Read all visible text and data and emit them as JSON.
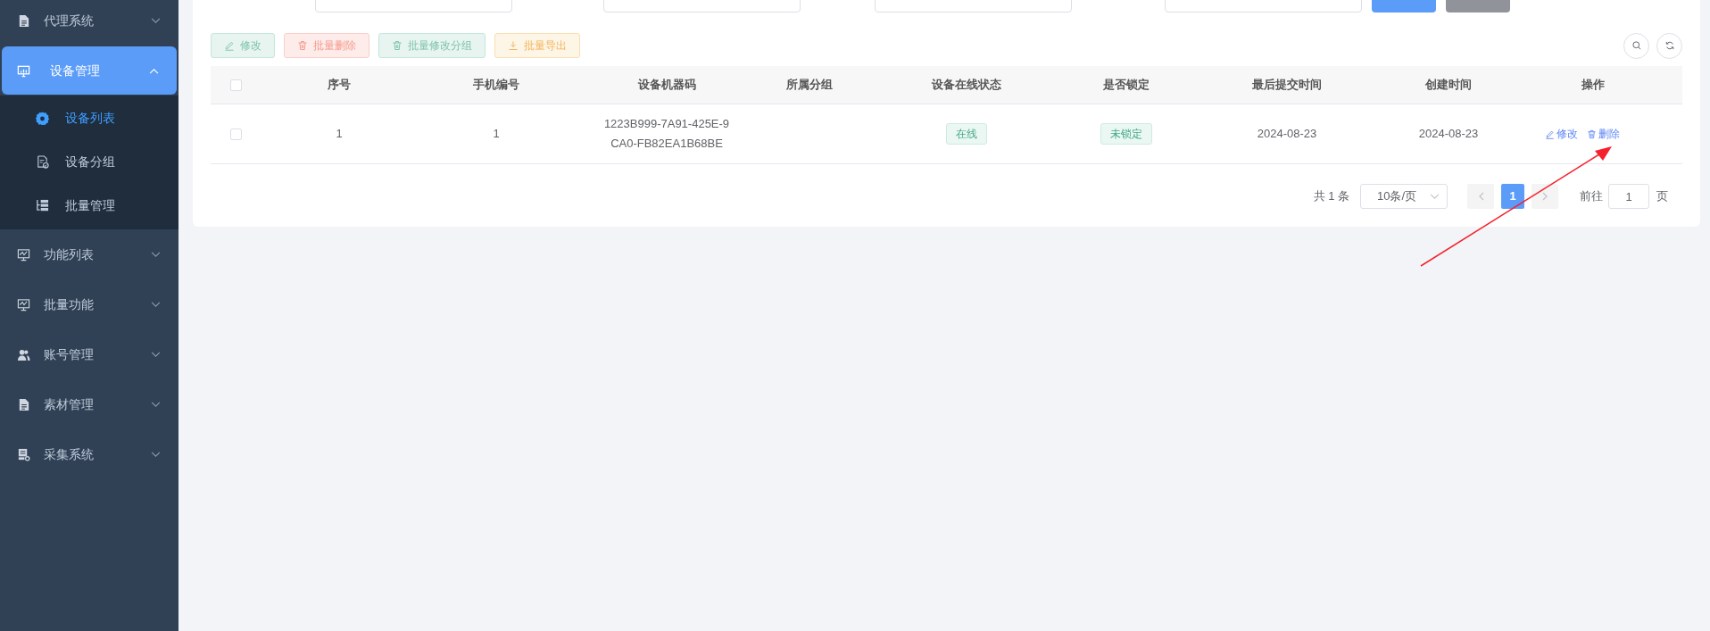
{
  "sidebar": {
    "items": [
      {
        "label": "代理系统",
        "kind": "doc",
        "expanded": false,
        "selected": false
      },
      {
        "label": "设备管理",
        "kind": "monitor",
        "expanded": true,
        "selected": true,
        "children": [
          {
            "label": "设备列表",
            "kind": "gear",
            "selected": true
          },
          {
            "label": "设备分组",
            "kind": "file-check",
            "selected": false
          },
          {
            "label": "批量管理",
            "kind": "tree",
            "selected": false
          }
        ]
      },
      {
        "label": "功能列表",
        "kind": "chart",
        "expanded": false,
        "selected": false
      },
      {
        "label": "批量功能",
        "kind": "chart",
        "expanded": false,
        "selected": false
      },
      {
        "label": "账号管理",
        "kind": "users",
        "expanded": false,
        "selected": false
      },
      {
        "label": "素材管理",
        "kind": "doc",
        "expanded": false,
        "selected": false
      },
      {
        "label": "采集系统",
        "kind": "db",
        "expanded": false,
        "selected": false
      }
    ]
  },
  "filters": {
    "fields": [
      {
        "kind": "input"
      },
      {
        "kind": "input"
      },
      {
        "kind": "input"
      },
      {
        "kind": "input"
      }
    ],
    "buttons": [
      {
        "kind": "primary"
      },
      {
        "kind": "reset"
      }
    ]
  },
  "toolbar": {
    "buttons": [
      {
        "label": "修改",
        "kind": "edit"
      },
      {
        "label": "批量删除",
        "kind": "delete"
      },
      {
        "label": "批量修改分组",
        "kind": "group"
      },
      {
        "label": "批量导出",
        "kind": "export"
      }
    ],
    "tools": [
      {
        "kind": "search"
      },
      {
        "kind": "refresh"
      }
    ]
  },
  "table": {
    "select_all": {
      "checked": false
    },
    "columns": [
      "序号",
      "手机编号",
      "设备机器码",
      "所属分组",
      "设备在线状态",
      "是否锁定",
      "最后提交时间",
      "创建时间",
      "操作"
    ],
    "rows": [
      {
        "checked": false,
        "index": "1",
        "phone_no": "1",
        "machine_code": "1223B999-7A91-425E-9CA0-FB82EA1B68BE",
        "online_status": "在线",
        "lock_status": "未锁定",
        "last_submit": "2024-08-23",
        "created": "2024-08-23",
        "actions": [
          {
            "label": "修改",
            "kind": "edit"
          },
          {
            "label": "删除",
            "kind": "delete"
          }
        ]
      }
    ]
  },
  "pagination": {
    "total": "共 1 条",
    "page_size": "10条/页",
    "pages": [
      {
        "label": "1",
        "selected": true
      }
    ],
    "goto_label": "前往",
    "goto_value": "1",
    "page_suffix": "页"
  }
}
